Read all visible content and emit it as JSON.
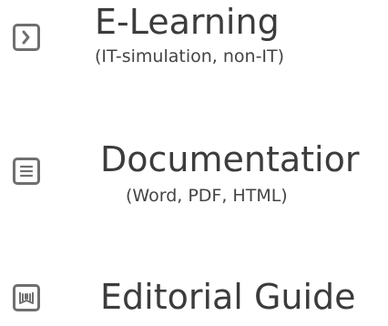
{
  "items": [
    {
      "title": "E-Learning",
      "subtitle": "(IT-simulation, non-IT)",
      "icon": "chevron-right-icon"
    },
    {
      "title": "Documentatior",
      "subtitle": "(Word, PDF, HTML)",
      "icon": "document-lines-icon"
    },
    {
      "title": "Editorial Guide",
      "subtitle": "",
      "icon": "book-icon"
    }
  ],
  "colors": {
    "icon": "#6f6f6f",
    "text": "#3c3c3c"
  }
}
